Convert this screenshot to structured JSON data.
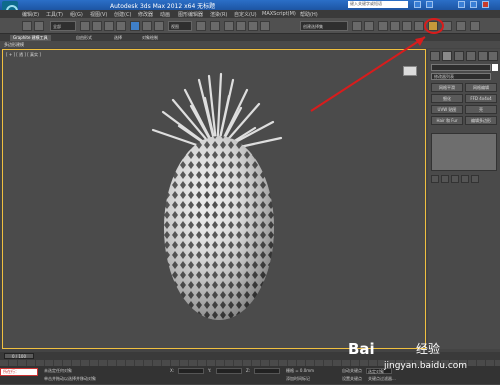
{
  "titlebar": {
    "title": "Autodesk 3ds Max 2012 x64  无标题",
    "search_placeholder": "键入关键字或短语"
  },
  "menubar": [
    "编辑(E)",
    "工具(T)",
    "组(G)",
    "视图(V)",
    "创建(C)",
    "修改器",
    "动画",
    "图形编辑器",
    "渲染(R)",
    "自定义(U)",
    "MAXScript(M)",
    "帮助(H)"
  ],
  "toolbar": {
    "filter_dropdown": "全部",
    "coord_dropdown": "视图",
    "selection_set": "创建选择集"
  },
  "ribbon": {
    "tabs": [
      "Graphite 建模工具",
      "自由形式",
      "选择",
      "对象绘制"
    ],
    "subtab": "多边形建模"
  },
  "viewport": {
    "label": "[ + ] [ 透 ] [ 真实 ]"
  },
  "command_panel": {
    "modifier_list": "修改器列表",
    "buttons": [
      "网格平滑",
      "网格编辑",
      "细化",
      "FFD 4x4x4",
      "UVW 贴图",
      "壳",
      "Hair 和 Fur",
      "编辑多边形"
    ]
  },
  "timeline": {
    "slider": "0 / 100"
  },
  "statusbar": {
    "mini_listener": "所在行：",
    "status_line": "未选定任何对象",
    "prompt_line": "单击并拖动以选择并移动对象",
    "coord_x": "X:",
    "coord_y": "Y:",
    "coord_z": "Z:",
    "grid": "栅格 = 0.0mm",
    "autokey": "自动关键点",
    "selected": "选定对象",
    "setkey": "设置关键点",
    "keyfilter": "关键点过滤器...",
    "add_time_tag": "添加时间标记"
  },
  "watermark": {
    "brand": "Bai",
    "brand2": "经验",
    "url": "jingyan.baidu.com"
  },
  "colors": {
    "annotation_red": "#d81c1c",
    "viewport_border": "#f0c040",
    "title_blue": "#1d55a3"
  }
}
